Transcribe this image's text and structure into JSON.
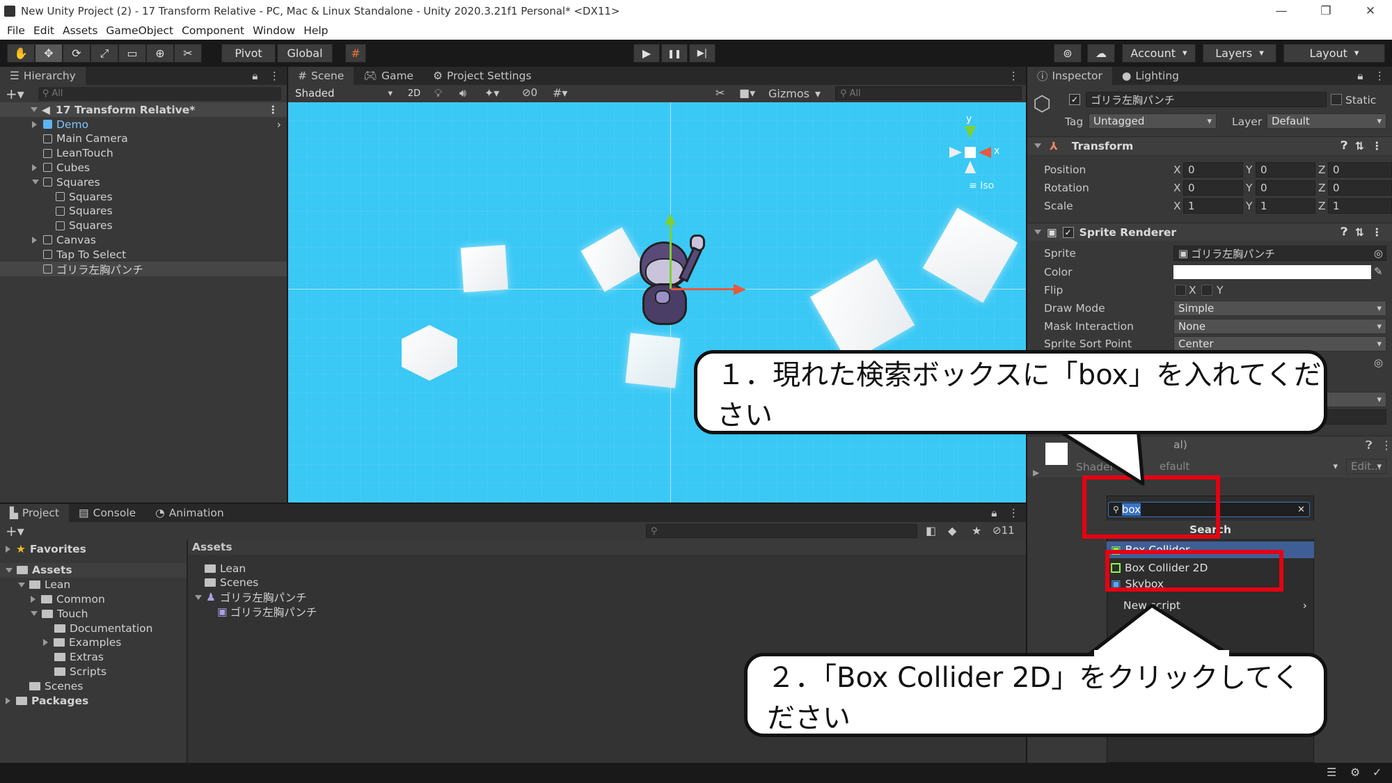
{
  "window": {
    "title": "New Unity Project (2) - 17    Transform Relative - PC, Mac & Linux Standalone - Unity 2020.3.21f1 Personal* <DX11>",
    "minimize": "—",
    "restore": "❐",
    "close": "✕"
  },
  "menu": [
    "File",
    "Edit",
    "Assets",
    "GameObject",
    "Component",
    "Window",
    "Help"
  ],
  "toolbar": {
    "pivot": "Pivot",
    "global": "Global",
    "account": "Account",
    "layers": "Layers",
    "layout": "Layout",
    "play": "▶",
    "pause": "❚❚",
    "step": "▶|"
  },
  "hierarchy": {
    "tab": "Hierarchy",
    "search_placeholder": "All",
    "scene_name": "17    Transform Relative*",
    "items": [
      {
        "label": "Demo",
        "indent": 1,
        "expandable": true,
        "highlight": true
      },
      {
        "label": "Main Camera",
        "indent": 1
      },
      {
        "label": "LeanTouch",
        "indent": 1
      },
      {
        "label": "Cubes",
        "indent": 1,
        "expandable": true
      },
      {
        "label": "Squares",
        "indent": 1,
        "expanded": true
      },
      {
        "label": "Squares",
        "indent": 2
      },
      {
        "label": "Squares",
        "indent": 2
      },
      {
        "label": "Squares",
        "indent": 2
      },
      {
        "label": "Canvas",
        "indent": 1,
        "expandable": true
      },
      {
        "label": "Tap To Select",
        "indent": 1
      },
      {
        "label": "ゴリラ左胸パンチ",
        "indent": 1,
        "selected": true
      }
    ]
  },
  "scene": {
    "tabs": [
      "Scene",
      "Game",
      "Project Settings"
    ],
    "shading": "Shaded",
    "mode2d": "2D",
    "hidden_count": "0",
    "gizmos": "Gizmos",
    "search_placeholder": "All",
    "gizmo_axis_x": "x",
    "gizmo_axis_y": "y",
    "iso": "Iso"
  },
  "inspector": {
    "tabs": [
      "Inspector",
      "Lighting"
    ],
    "object_name": "ゴリラ左胸パンチ",
    "static": "Static",
    "tag_label": "Tag",
    "tag_value": "Untagged",
    "layer_label": "Layer",
    "layer_value": "Default",
    "transform": {
      "title": "Transform",
      "rows": [
        {
          "label": "Position",
          "x": "0",
          "y": "0",
          "z": "0"
        },
        {
          "label": "Rotation",
          "x": "0",
          "y": "0",
          "z": "0"
        },
        {
          "label": "Scale",
          "x": "1",
          "y": "1",
          "z": "1"
        }
      ]
    },
    "sprite_renderer": {
      "title": "Sprite Renderer",
      "sprite_label": "Sprite",
      "sprite_value": "ゴリラ左胸パンチ",
      "color_label": "Color",
      "flip_label": "Flip",
      "flip_x": "X",
      "flip_y": "Y",
      "draw_mode_label": "Draw Mode",
      "draw_mode_value": "Simple",
      "mask_label": "Mask Interaction",
      "mask_value": "None",
      "sort_label": "Sprite Sort Point",
      "sort_value": "Center"
    },
    "material": {
      "title": "al)",
      "shader_label": "Shader",
      "shader_value": "efault",
      "edit": "Edit..."
    }
  },
  "add_component": {
    "search_value": "box",
    "header": "Search",
    "items": [
      "Box Collider",
      "Box Collider 2D",
      "Skybox",
      "New script"
    ]
  },
  "project": {
    "tabs": [
      "Project",
      "Console",
      "Animation"
    ],
    "hidden_count": "11",
    "tree": [
      {
        "label": "Favorites",
        "indent": 0,
        "bold": true,
        "star": true
      },
      {
        "label": "Assets",
        "indent": 0,
        "bold": true,
        "expanded": true
      },
      {
        "label": "Lean",
        "indent": 1,
        "expanded": true
      },
      {
        "label": "Common",
        "indent": 2,
        "expandable": true
      },
      {
        "label": "Touch",
        "indent": 2,
        "expanded": true
      },
      {
        "label": "Documentation",
        "indent": 3
      },
      {
        "label": "Examples",
        "indent": 3,
        "expandable": true
      },
      {
        "label": "Extras",
        "indent": 3
      },
      {
        "label": "Scripts",
        "indent": 3
      },
      {
        "label": "Scenes",
        "indent": 1
      },
      {
        "label": "Packages",
        "indent": 0,
        "bold": true,
        "expandable": true
      }
    ],
    "breadcrumb": "Assets",
    "files": [
      {
        "label": "Lean",
        "type": "folder",
        "indent": 0
      },
      {
        "label": "Scenes",
        "type": "folder",
        "indent": 0
      },
      {
        "label": "ゴリラ左胸パンチ",
        "type": "texture",
        "indent": 0
      },
      {
        "label": "ゴリラ左胸パンチ",
        "type": "sprite",
        "indent": 1
      }
    ]
  },
  "callouts": {
    "step1": "１．現れた検索ボックスに「box」を入れてください",
    "step2": "２．「Box Collider 2D」をクリックしてください"
  },
  "colors": {
    "scene_bg": "#3ac8f5",
    "accent_red": "#e60012",
    "selection_blue": "#3e5f96"
  }
}
